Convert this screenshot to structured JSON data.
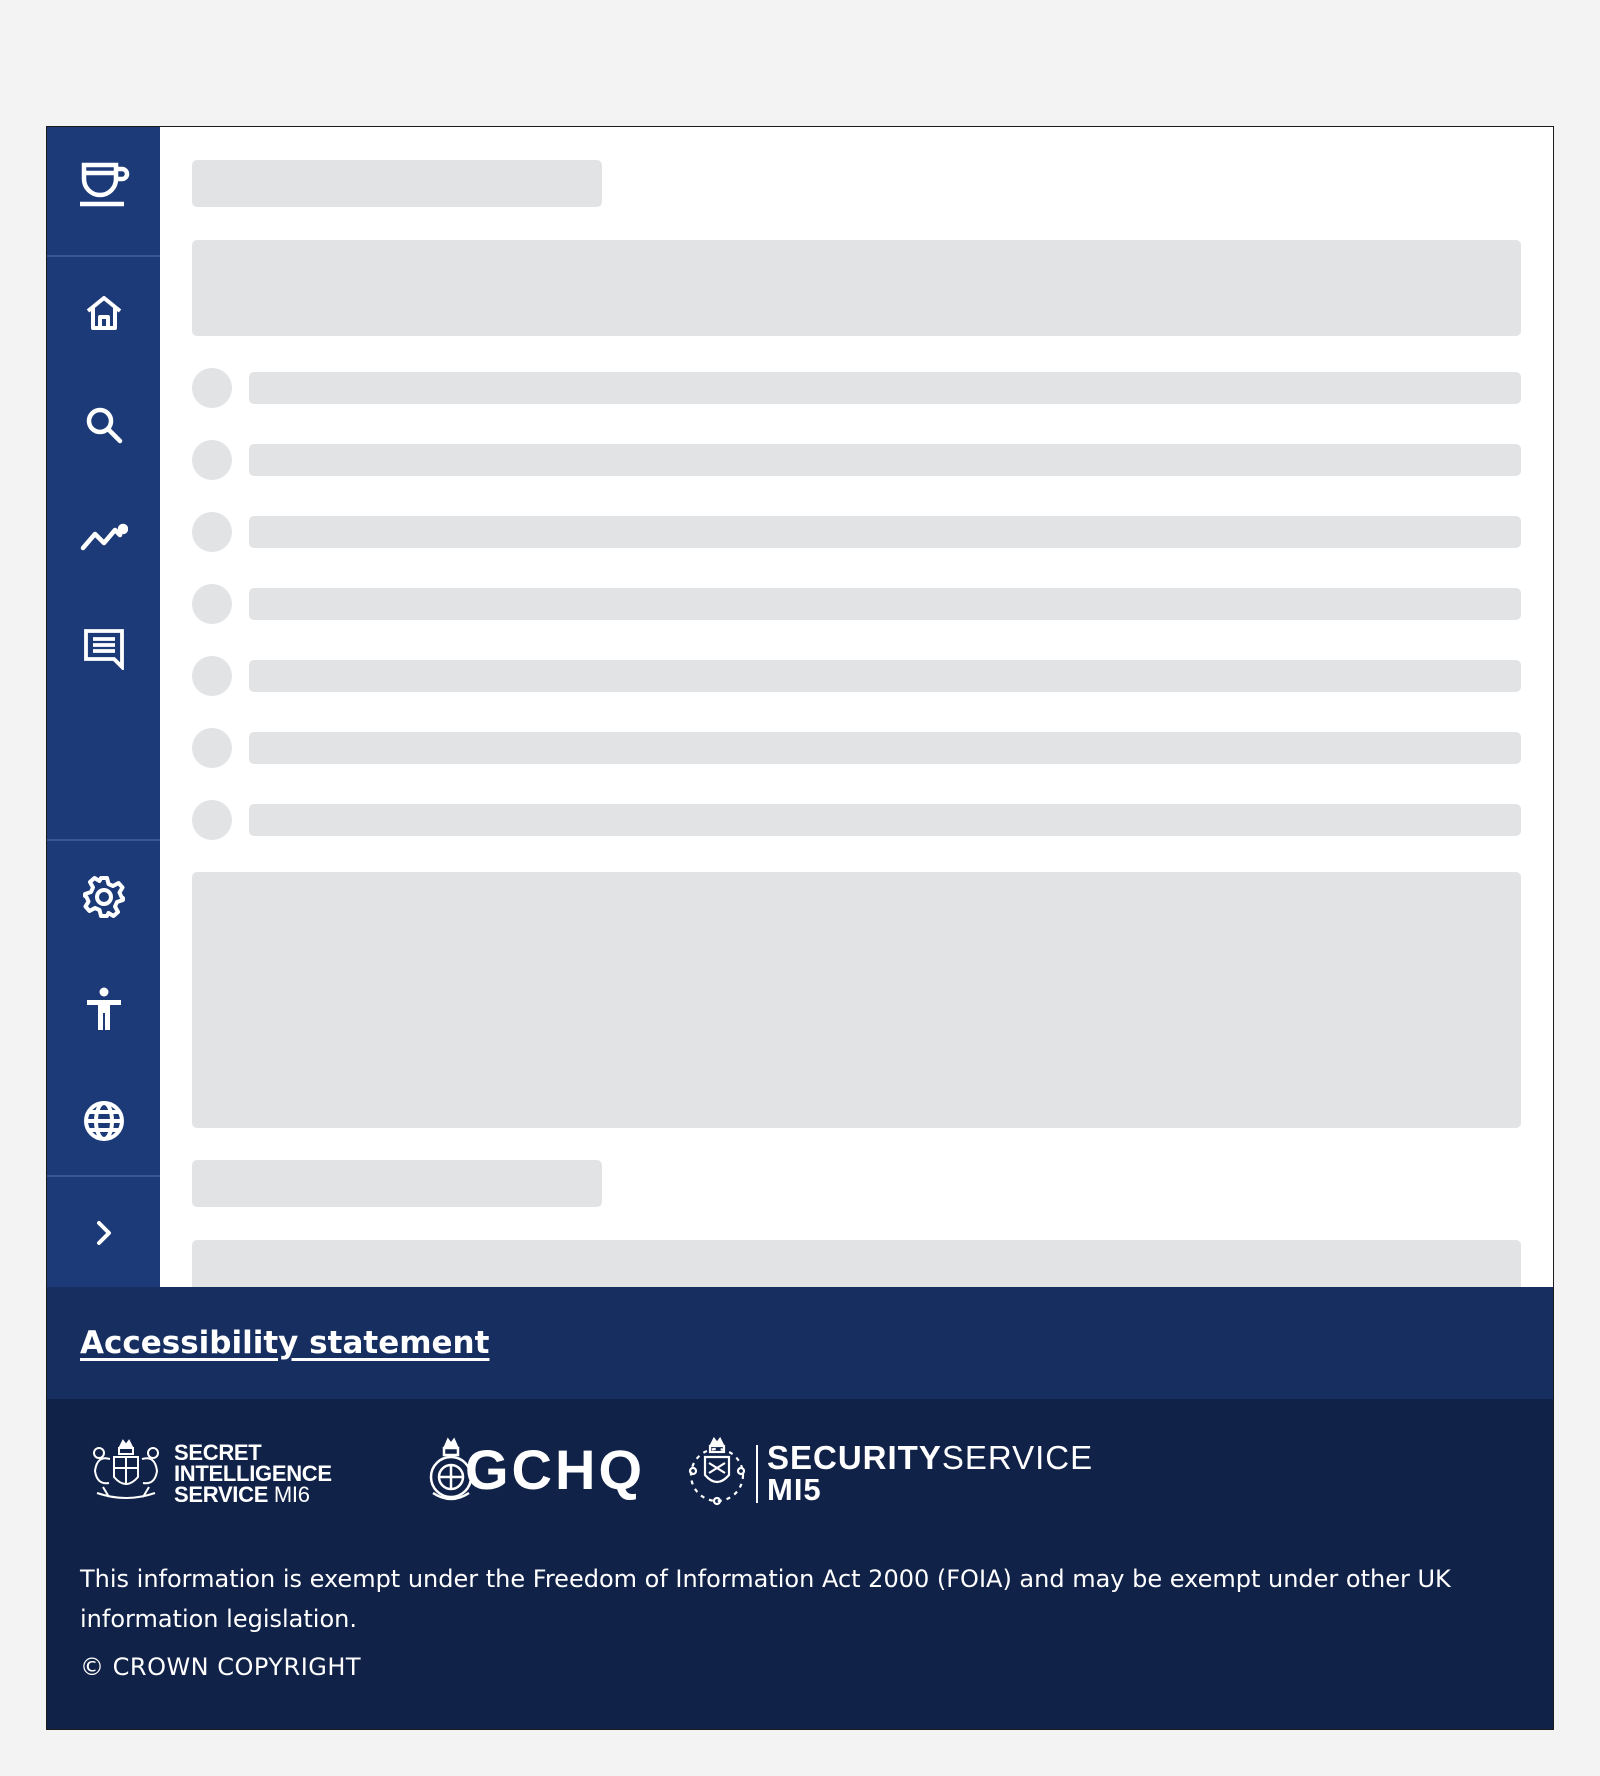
{
  "sidebar": {
    "items": [
      {
        "icon": "cup-icon",
        "label": ""
      },
      {
        "icon": "home-icon",
        "label": ""
      },
      {
        "icon": "search-icon",
        "label": ""
      },
      {
        "icon": "trend-icon",
        "label": ""
      },
      {
        "icon": "message-icon",
        "label": ""
      },
      {
        "icon": "gear-icon",
        "label": ""
      },
      {
        "icon": "accessibility-icon",
        "label": ""
      },
      {
        "icon": "globe-icon",
        "label": ""
      },
      {
        "icon": "chevron-right-icon",
        "label": ""
      }
    ],
    "background": "#1d3a78"
  },
  "main": {
    "state": "loading",
    "skeleton_color": "#e2e3e5",
    "skeleton_list_rows": 7
  },
  "footer": {
    "accessibility_link": "Accessibility statement",
    "logos": {
      "mi6": {
        "line1": "SECRET",
        "line2": "INTELLIGENCE",
        "line3": "SERVICE",
        "line3_suffix": "MI6"
      },
      "gchq": {
        "text": "GCHQ"
      },
      "mi5": {
        "line1_bold": "SECURITY",
        "line1_light": "SERVICE",
        "line2": "MI5"
      }
    },
    "legal_text": "This information is exempt under the Freedom of Information Act 2000 (FOIA) and may be exempt under other UK information legislation.",
    "copyright": "© CROWN COPYRIGHT",
    "colors": {
      "top": "#172e60",
      "bottom": "#112248"
    }
  }
}
